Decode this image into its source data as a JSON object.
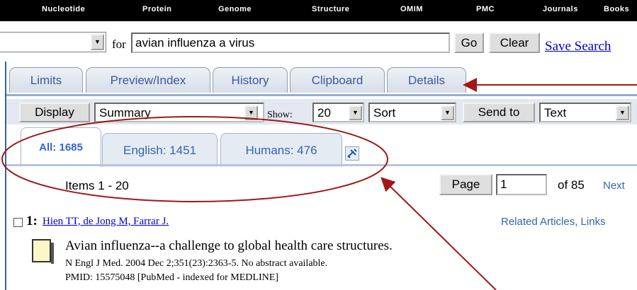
{
  "topnav": {
    "items": [
      "Nucleotide",
      "Protein",
      "Genome",
      "Structure",
      "OMIM",
      "PMC",
      "Journals",
      "Books"
    ]
  },
  "search": {
    "db_value": "",
    "for_label": "for",
    "query": "avian influenza a virus",
    "go_label": "Go",
    "clear_label": "Clear",
    "save_label": "Save Search"
  },
  "tabs": [
    "Limits",
    "Preview/Index",
    "History",
    "Clipboard",
    "Details"
  ],
  "display": {
    "display_label": "Display",
    "format": "Summary",
    "show_label": "Show:",
    "show_value": "20",
    "sort_value": "Sort",
    "send_label": "Send to",
    "send_value": "Text"
  },
  "filters": [
    "All: 1685",
    "English: 1451",
    "Humans: 476"
  ],
  "paging": {
    "items": "Items 1 - 20",
    "page_label": "Page",
    "page_value": "1",
    "of_label": "of 85",
    "next_label": "Next"
  },
  "result": {
    "number": "1:",
    "authors": "Hien TT, de Jong M, Farrar J.",
    "related": "Related Articles, Links",
    "title": "Avian influenza--a challenge to global health care structures.",
    "citation": "N Engl J Med. 2004 Dec 2;351(23):2363-5. No abstract available.",
    "pmid": "PMID: 15575048 [PubMed - indexed for MEDLINE]"
  },
  "colors": {
    "annotation": "#a01818",
    "tab_text": "#3b5998",
    "link": "#0000cc"
  }
}
